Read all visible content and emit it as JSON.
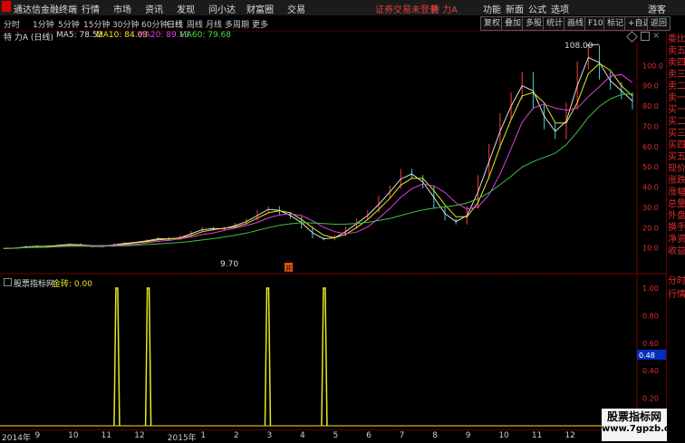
{
  "menubar": {
    "app_name": "通达信金融终端",
    "menus": [
      "行情",
      "市场",
      "资讯",
      "发现",
      "问小达",
      "财富圈",
      "交易"
    ],
    "login_status": "证券交易未登录",
    "stock_name": "特 力A",
    "right_menus": [
      "功能",
      "新面",
      "公式",
      "选项"
    ],
    "guest": "游客"
  },
  "toolbar": {
    "periods": [
      "分时",
      "1分钟",
      "5分钟",
      "15分钟",
      "30分钟",
      "60分钟",
      "日线",
      "周线",
      "月线",
      "多周期",
      "更多"
    ],
    "active_period": "日线",
    "buttons": [
      "复权",
      "叠加",
      "多股",
      "统计",
      "画线",
      "F10",
      "标记",
      "+自选",
      "返回"
    ]
  },
  "info": {
    "title": "特 力A (日线)",
    "ma5": "MA5: 78.52",
    "ma10": "MA10: 84.03",
    "ma20": "MA20: 89.13",
    "ma60": "MA60: 79.68"
  },
  "price_axis": [
    "100.0",
    "90.0",
    "80.0",
    "70.0",
    "60.0",
    "50.0",
    "40.0",
    "30.0",
    "20.0",
    "10.0"
  ],
  "annotations": {
    "high": "108.00",
    "low": "9.70",
    "marker": "开"
  },
  "indicator": {
    "name": "股票指标网",
    "value_label": "金砖: 0.00",
    "axis": [
      "1.00",
      "0.80",
      "0.60",
      "0.40",
      "0.20"
    ],
    "current": "0.48"
  },
  "date_axis": [
    "2014年",
    "9",
    "10",
    "11",
    "12",
    "2015年",
    "1",
    "2",
    "3",
    "4",
    "5",
    "6",
    "7",
    "8",
    "9",
    "10",
    "11",
    "12"
  ],
  "sidebar": [
    "委比",
    "卖五",
    "卖四",
    "卖三",
    "卖二",
    "卖一",
    "买一",
    "买二",
    "买三",
    "买四",
    "买五",
    "现价",
    "涨跌",
    "涨幅",
    "总量",
    "外盘",
    "换手",
    "净资",
    "收益"
  ],
  "sidebar_bottom": [
    "分时",
    "行情"
  ],
  "watermark": {
    "title": "股票指标网",
    "url": "www.7gpzb.com"
  },
  "chart_data": {
    "type": "line",
    "price_series": [
      {
        "name": "price",
        "values": [
          9.7,
          10,
          11,
          10.5,
          11,
          11.5,
          12,
          11,
          10.5,
          11,
          12,
          12.5,
          13,
          14,
          15,
          14,
          16,
          18,
          20,
          19,
          20,
          22,
          24,
          28,
          30,
          27,
          25,
          20,
          15,
          14,
          16,
          20,
          24,
          28,
          35,
          40,
          48,
          45,
          40,
          30,
          24,
          22,
          30,
          45,
          60,
          75,
          85,
          95,
          80,
          70,
          65,
          80,
          100,
          108,
          95,
          90,
          85,
          80
        ]
      }
    ],
    "ma": [
      "MA5",
      "MA10",
      "MA20",
      "MA60"
    ],
    "ylim": [
      0,
      110
    ],
    "signal_spikes": [
      0.18,
      0.23,
      0.42,
      0.51
    ]
  }
}
